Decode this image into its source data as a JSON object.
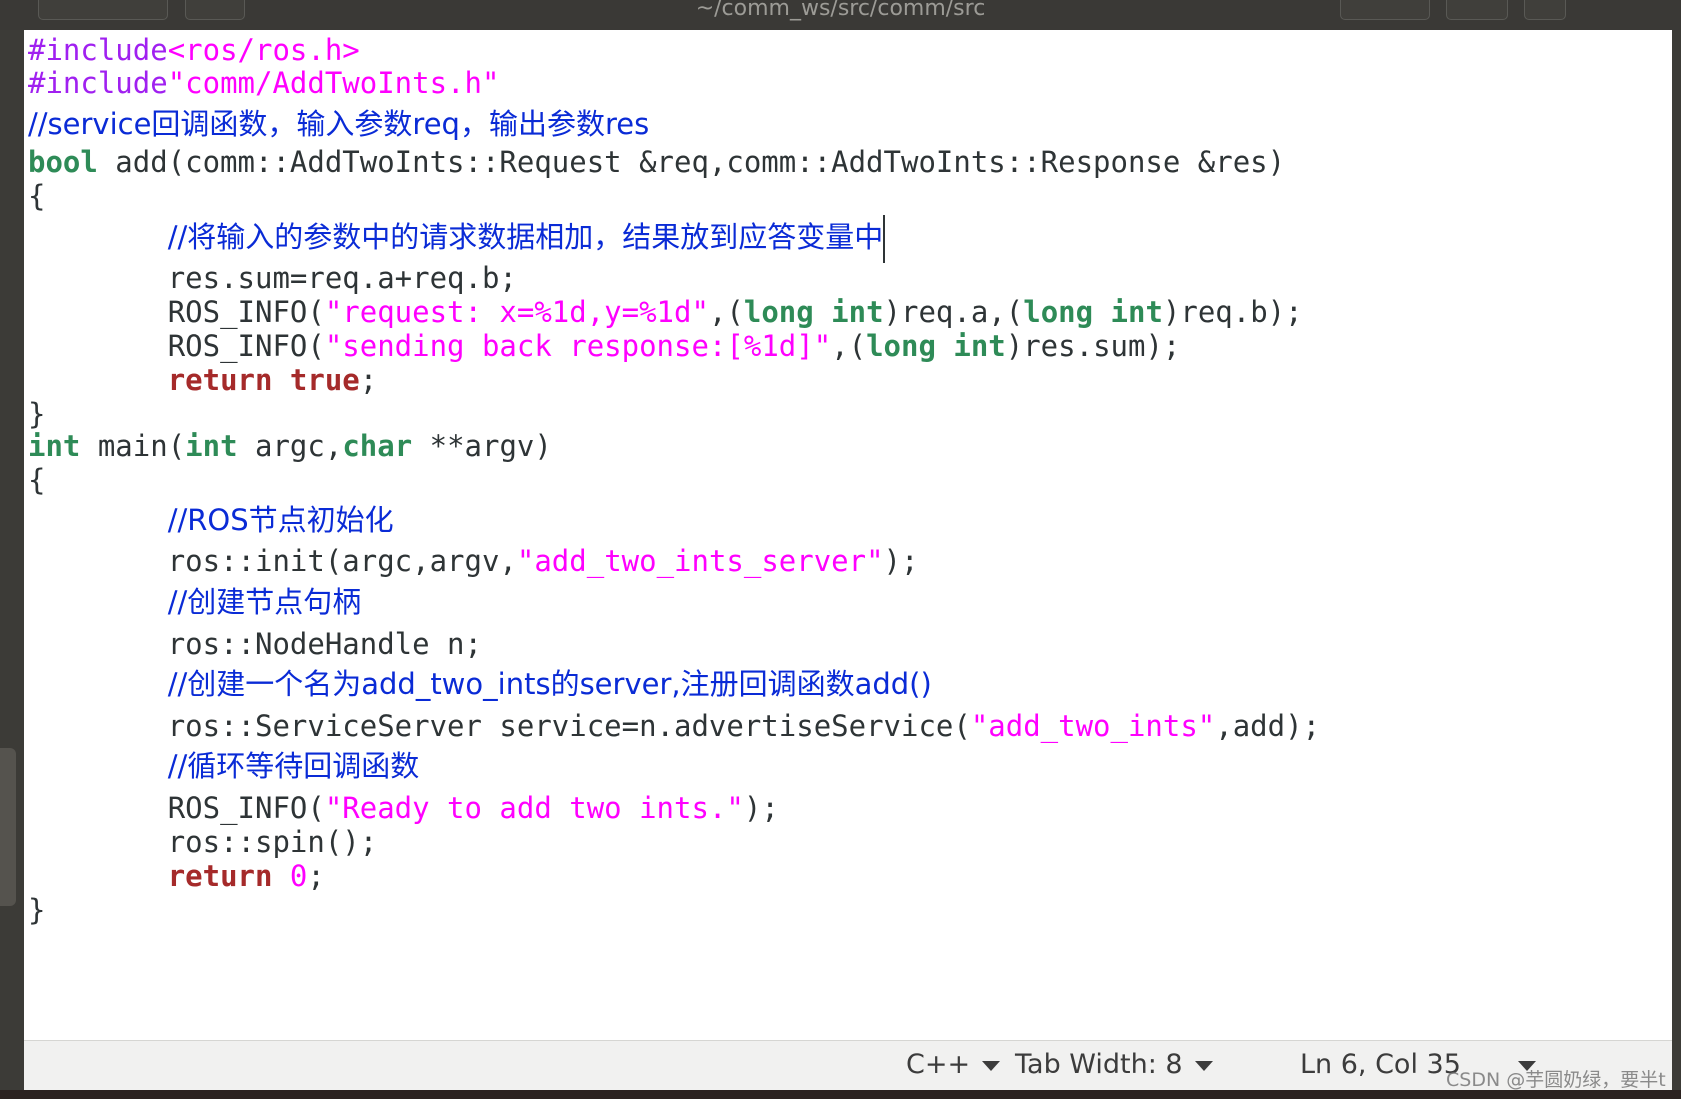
{
  "window": {
    "title": "~/comm_ws/src/comm/src"
  },
  "editor": {
    "lines": [
      {
        "indent": "",
        "segments": [
          {
            "c": "pp",
            "t": "#include"
          },
          {
            "c": "str",
            "t": "<ros/ros.h>"
          }
        ]
      },
      {
        "indent": "",
        "segments": [
          {
            "c": "pp",
            "t": "#include"
          },
          {
            "c": "str",
            "t": "\"comm/AddTwoInts.h\""
          }
        ]
      },
      {
        "indent": "",
        "segments": [
          {
            "c": "cm",
            "t": "//service回调函数，输入参数req，输出参数res"
          }
        ]
      },
      {
        "indent": "",
        "segments": [
          {
            "c": "ty",
            "t": "bool"
          },
          {
            "c": "",
            "t": " add(comm::AddTwoInts::Request &req,comm::AddTwoInts::Response &res)"
          }
        ]
      },
      {
        "indent": "",
        "segments": [
          {
            "c": "",
            "t": "{"
          }
        ]
      },
      {
        "indent": "        ",
        "segments": [
          {
            "c": "cm",
            "t": "//将输入的参数中的请求数据相加，结果放到应答变量中"
          },
          {
            "c": "caret",
            "t": ""
          }
        ]
      },
      {
        "indent": "        ",
        "segments": [
          {
            "c": "",
            "t": "res.sum=req.a+req.b;"
          }
        ]
      },
      {
        "indent": "        ",
        "segments": [
          {
            "c": "",
            "t": "ROS_INFO("
          },
          {
            "c": "str",
            "t": "\"request: x=%1d,y=%1d\""
          },
          {
            "c": "",
            "t": ",("
          },
          {
            "c": "ty",
            "t": "long int"
          },
          {
            "c": "",
            "t": ")req.a,("
          },
          {
            "c": "ty",
            "t": "long int"
          },
          {
            "c": "",
            "t": ")req.b);"
          }
        ]
      },
      {
        "indent": "        ",
        "segments": [
          {
            "c": "",
            "t": "ROS_INFO("
          },
          {
            "c": "str",
            "t": "\"sending back response:[%1d]\""
          },
          {
            "c": "",
            "t": ",("
          },
          {
            "c": "ty",
            "t": "long int"
          },
          {
            "c": "",
            "t": ")res.sum);"
          }
        ]
      },
      {
        "indent": "        ",
        "segments": [
          {
            "c": "kw",
            "t": "return"
          },
          {
            "c": "",
            "t": " "
          },
          {
            "c": "kw",
            "t": "true"
          },
          {
            "c": "",
            "t": ";"
          }
        ]
      },
      {
        "indent": "",
        "segments": [
          {
            "c": "",
            "t": "}"
          }
        ]
      },
      {
        "indent": "",
        "segments": [
          {
            "c": "ty",
            "t": "int"
          },
          {
            "c": "",
            "t": " main("
          },
          {
            "c": "ty",
            "t": "int"
          },
          {
            "c": "",
            "t": " argc,"
          },
          {
            "c": "ty",
            "t": "char"
          },
          {
            "c": "",
            "t": " **argv)"
          }
        ]
      },
      {
        "indent": "",
        "segments": [
          {
            "c": "",
            "t": "{"
          }
        ]
      },
      {
        "indent": "        ",
        "segments": [
          {
            "c": "cm",
            "t": "//ROS节点初始化"
          }
        ]
      },
      {
        "indent": "        ",
        "segments": [
          {
            "c": "",
            "t": "ros::init(argc,argv,"
          },
          {
            "c": "str",
            "t": "\"add_two_ints_server\""
          },
          {
            "c": "",
            "t": ");"
          }
        ]
      },
      {
        "indent": "        ",
        "segments": [
          {
            "c": "cm",
            "t": "//创建节点句柄"
          }
        ]
      },
      {
        "indent": "        ",
        "segments": [
          {
            "c": "",
            "t": "ros::NodeHandle n;"
          }
        ]
      },
      {
        "indent": "        ",
        "segments": [
          {
            "c": "cm",
            "t": "//创建一个名为add_two_ints的server,注册回调函数add()"
          }
        ]
      },
      {
        "indent": "        ",
        "segments": [
          {
            "c": "",
            "t": "ros::ServiceServer service=n.advertiseService("
          },
          {
            "c": "str",
            "t": "\"add_two_ints\""
          },
          {
            "c": "",
            "t": ",add);"
          }
        ]
      },
      {
        "indent": "        ",
        "segments": [
          {
            "c": "cm",
            "t": "//循环等待回调函数"
          }
        ]
      },
      {
        "indent": "        ",
        "segments": [
          {
            "c": "",
            "t": "ROS_INFO("
          },
          {
            "c": "str",
            "t": "\"Ready to add two ints.\""
          },
          {
            "c": "",
            "t": ");"
          }
        ]
      },
      {
        "indent": "        ",
        "segments": [
          {
            "c": "",
            "t": "ros::spin();"
          }
        ]
      },
      {
        "indent": "        ",
        "segments": [
          {
            "c": "kw",
            "t": "return"
          },
          {
            "c": "",
            "t": " "
          },
          {
            "c": "num",
            "t": "0"
          },
          {
            "c": "",
            "t": ";"
          }
        ]
      },
      {
        "indent": "",
        "segments": [
          {
            "c": "",
            "t": "}"
          }
        ]
      }
    ]
  },
  "statusbar": {
    "language": "C++",
    "tab_width": "Tab Width: 8",
    "position": "Ln 6, Col 35"
  },
  "watermark": "CSDN @芋圆奶绿，要半t"
}
